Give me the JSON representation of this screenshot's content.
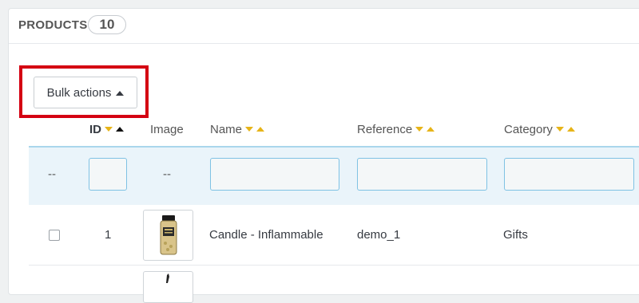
{
  "panel": {
    "title": "PRODUCTS",
    "count": "10"
  },
  "toolbar": {
    "bulk_actions_label": "Bulk actions"
  },
  "table": {
    "columns": [
      {
        "key": "id",
        "label": "ID",
        "sort": "asc"
      },
      {
        "key": "image",
        "label": "Image"
      },
      {
        "key": "name",
        "label": "Name"
      },
      {
        "key": "reference",
        "label": "Reference"
      },
      {
        "key": "category",
        "label": "Category"
      }
    ],
    "filter": {
      "select_placeholder": "--",
      "image_placeholder": "--",
      "id_value": "",
      "name_value": "",
      "reference_value": "",
      "category_value": ""
    },
    "rows": [
      {
        "id": "1",
        "name": "Candle - Inflammable",
        "reference": "demo_1",
        "category": "Gifts",
        "image_icon": "candle-jar-thumbnail"
      }
    ]
  },
  "colors": {
    "highlight": "#d40012",
    "sort_arrow": "#e7b418",
    "filter_bg": "#eaf4fa",
    "input_border": "#7fc2e4"
  }
}
